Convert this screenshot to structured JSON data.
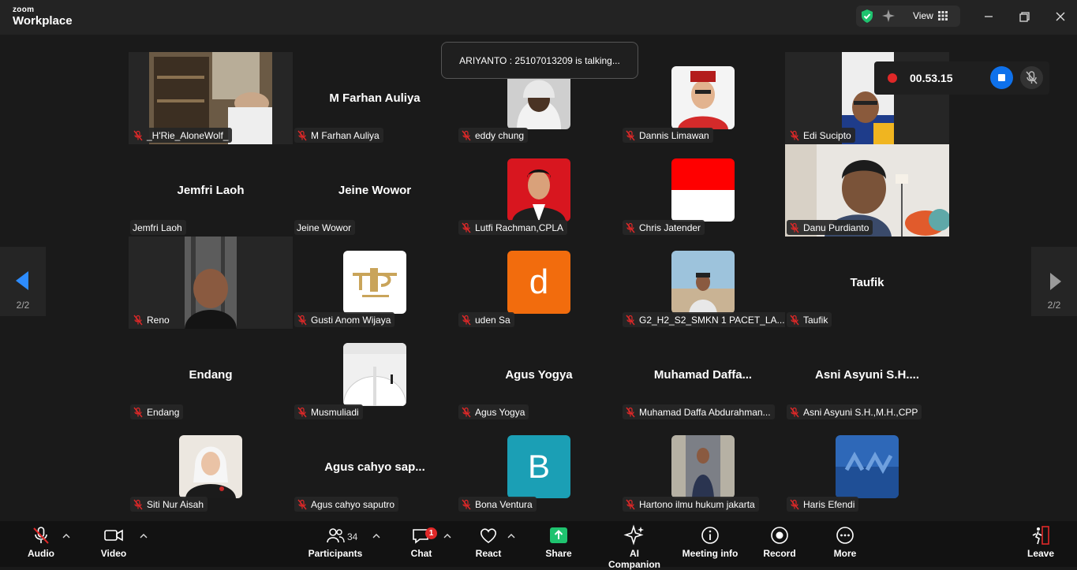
{
  "app": {
    "brand_small": "zoom",
    "brand_big": "Workplace",
    "view_label": "View"
  },
  "talking": "ARIYANTO : 25107013209 is talking...",
  "recording": {
    "time": "00.53.15"
  },
  "pager": {
    "current": "2/2"
  },
  "participants": [
    {
      "name": "_H'Rie_AloneWolf_",
      "display": "",
      "kind": "video"
    },
    {
      "name": "M Farhan Auliya",
      "display": "M Farhan Auliya",
      "kind": "text"
    },
    {
      "name": "eddy chung",
      "display": "",
      "kind": "photo"
    },
    {
      "name": "Dannis Limawan",
      "display": "",
      "kind": "photo"
    },
    {
      "name": "Edi Sucipto",
      "display": "",
      "kind": "video"
    },
    {
      "name": "Jemfri Laoh",
      "display": "Jemfri Laoh",
      "kind": "text"
    },
    {
      "name": "Jeine Wowor",
      "display": "Jeine Wowor",
      "kind": "text"
    },
    {
      "name": "Lutfi Rachman,CPLA",
      "display": "",
      "kind": "photo"
    },
    {
      "name": "Chris Jatender",
      "display": "",
      "kind": "photo"
    },
    {
      "name": "Danu Purdianto",
      "display": "",
      "kind": "video"
    },
    {
      "name": "Reno",
      "display": "",
      "kind": "video"
    },
    {
      "name": "Gusti Anom Wijaya",
      "display": "",
      "kind": "photo"
    },
    {
      "name": "uden Sa",
      "display": "d",
      "kind": "letter"
    },
    {
      "name": "G2_H2_S2_SMKN 1 PACET_LA...",
      "display": "",
      "kind": "photo"
    },
    {
      "name": "Taufik",
      "display": "Taufik",
      "kind": "text"
    },
    {
      "name": "Endang",
      "display": "Endang",
      "kind": "text"
    },
    {
      "name": "Musmuliadi",
      "display": "",
      "kind": "photo"
    },
    {
      "name": "Agus Yogya",
      "display": "Agus Yogya",
      "kind": "text"
    },
    {
      "name": "Muhamad Daffa Abdurahman...",
      "display": "Muhamad  Daffa...",
      "kind": "text"
    },
    {
      "name": "Asni Asyuni S.H.,M.H.,CPP",
      "display": "Asni  Asyuni S.H....",
      "kind": "text"
    },
    {
      "name": "Siti Nur Aisah",
      "display": "",
      "kind": "photo"
    },
    {
      "name": "Agus cahyo saputro",
      "display": "Agus cahyo sap...",
      "kind": "text"
    },
    {
      "name": "Bona Ventura",
      "display": "B",
      "kind": "letter"
    },
    {
      "name": "Hartono ilmu hukum jakarta",
      "display": "",
      "kind": "photo"
    },
    {
      "name": "Haris Efendi",
      "display": "",
      "kind": "photo"
    }
  ],
  "toolbar": {
    "audio": "Audio",
    "video": "Video",
    "participants": "Participants",
    "participants_count": "34",
    "chat": "Chat",
    "chat_badge": "1",
    "react": "React",
    "share": "Share",
    "ai_companion": "AI Companion",
    "meeting_info": "Meeting info",
    "record": "Record",
    "more": "More",
    "leave": "Leave"
  },
  "colors": {
    "accent": "#0e71eb",
    "share": "#1fc36f",
    "record": "#e02828",
    "uden": "#f26c0d",
    "bona": "#1b9fb5"
  }
}
